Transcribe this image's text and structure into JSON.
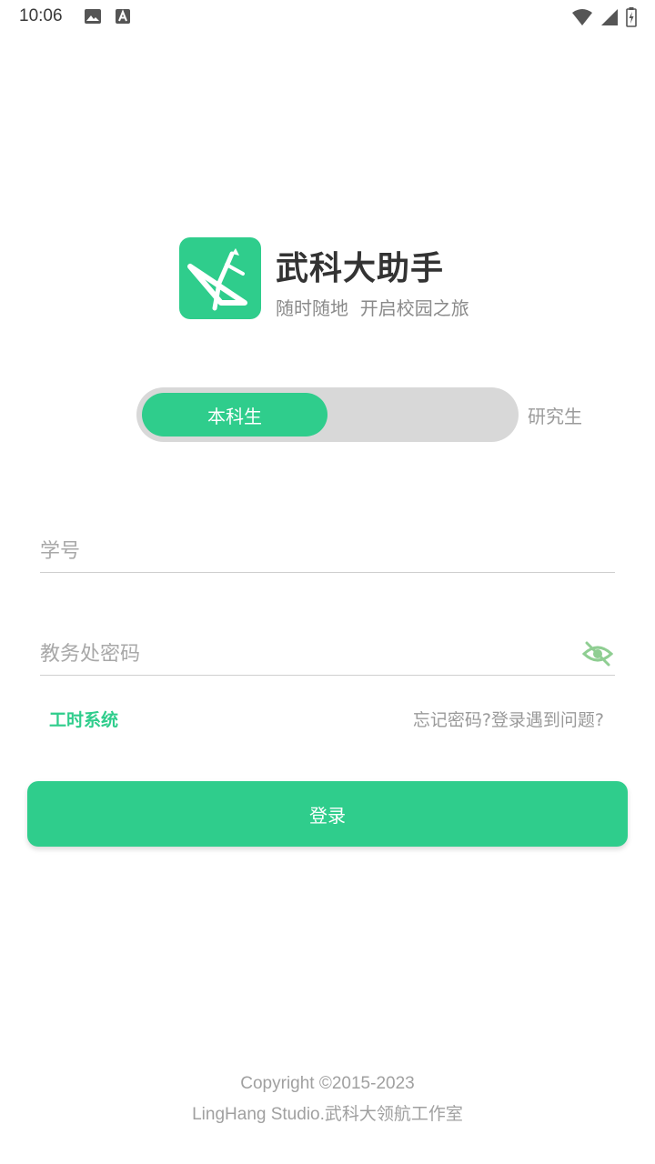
{
  "status_bar": {
    "time": "10:06",
    "left_icons": [
      "image-icon",
      "font-a-icon"
    ],
    "right_icons": [
      "wifi-icon",
      "signal-icon",
      "battery-icon"
    ]
  },
  "header": {
    "logo_icon": "compass-ruler-icon",
    "title": "武科大助手",
    "slogan": "随时随地  开启校园之旅"
  },
  "student_type_toggle": {
    "options": [
      {
        "label": "本科生",
        "active": true
      },
      {
        "label": "研究生",
        "active": false
      }
    ]
  },
  "form": {
    "student_id": {
      "value": "",
      "placeholder": "学号"
    },
    "password": {
      "value": "",
      "placeholder": "教务处密码",
      "visibility_icon": "eye-off-icon"
    }
  },
  "links": {
    "worktime_system": "工时系统",
    "help": "忘记密码?登录遇到问题?"
  },
  "login_button": {
    "label": "登录"
  },
  "footer": {
    "line1": "Copyright ©2015-2023",
    "line2": "LingHang Studio.武科大领航工作室"
  },
  "colors": {
    "accent": "#2fcd8c",
    "toggle_bg": "#d8d8d8",
    "text_muted": "#a0a0a0"
  }
}
